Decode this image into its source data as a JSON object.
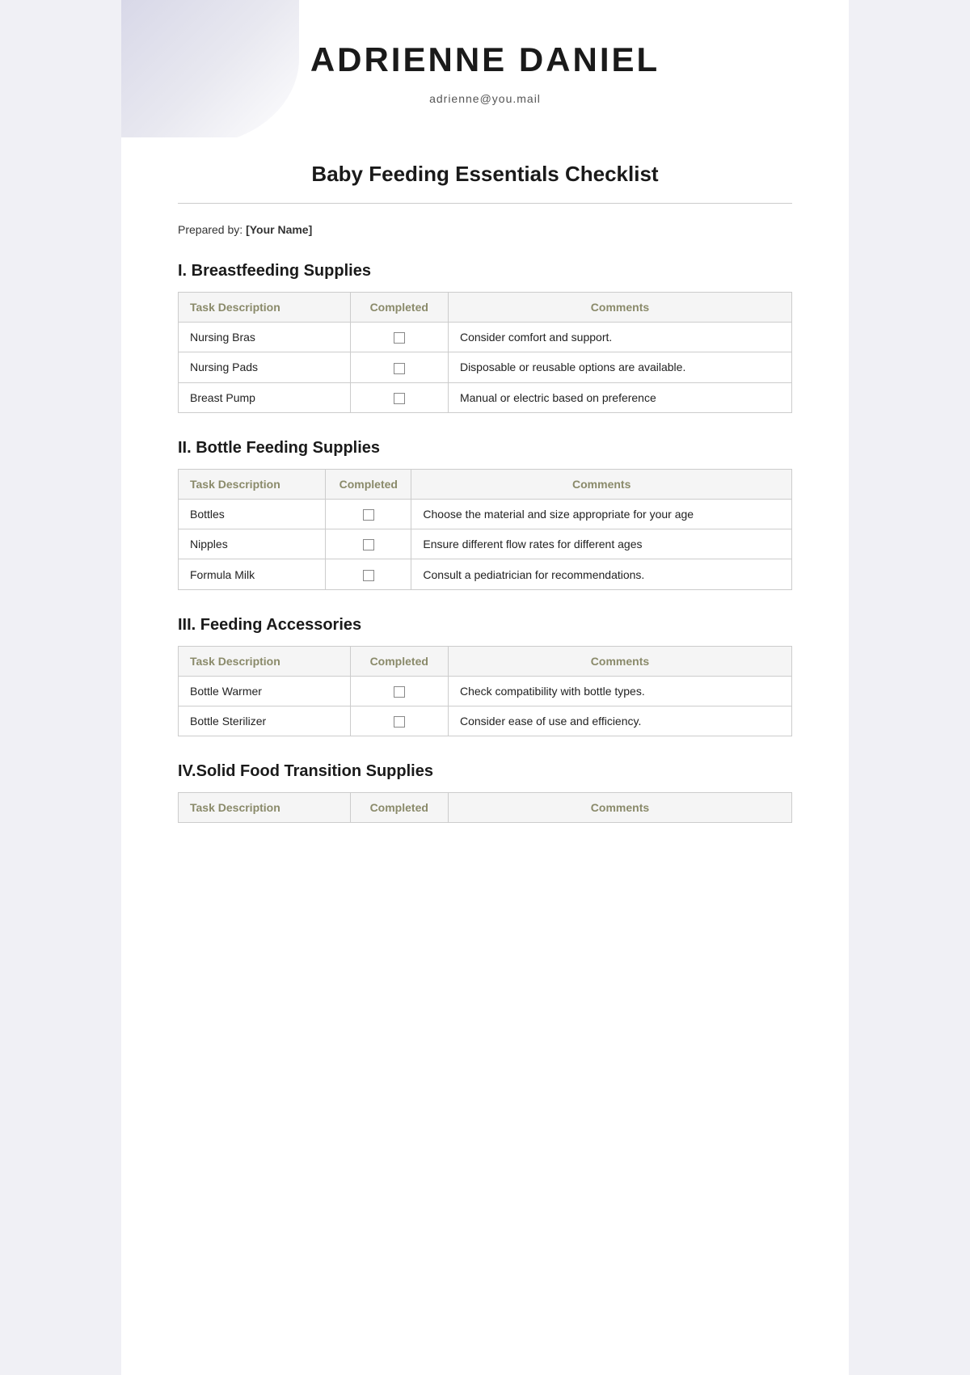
{
  "header": {
    "name": "ADRIENNE DANIEL",
    "email": "adrienne@you.mail"
  },
  "document": {
    "title": "Baby Feeding Essentials Checklist",
    "prepared_by_label": "Prepared by:",
    "prepared_by_value": "[Your Name]"
  },
  "sections": [
    {
      "id": "breastfeeding",
      "title": "I. Breastfeeding Supplies",
      "columns": [
        "Task Description",
        "Completed",
        "Comments"
      ],
      "rows": [
        {
          "task": "Nursing Bras",
          "completed": false,
          "comments": "Consider comfort and support."
        },
        {
          "task": "Nursing Pads",
          "completed": false,
          "comments": "Disposable or reusable options are available."
        },
        {
          "task": "Breast Pump",
          "completed": false,
          "comments": "Manual or electric based on preference"
        }
      ]
    },
    {
      "id": "bottle-feeding",
      "title": "II. Bottle Feeding Supplies",
      "columns": [
        "Task Description",
        "Completed",
        "Comments"
      ],
      "rows": [
        {
          "task": "Bottles",
          "completed": false,
          "comments": "Choose the material and size appropriate for your age"
        },
        {
          "task": "Nipples",
          "completed": false,
          "comments": "Ensure different flow rates for different ages"
        },
        {
          "task": "Formula Milk",
          "completed": false,
          "comments": "Consult a pediatrician for recommendations."
        }
      ]
    },
    {
      "id": "feeding-accessories",
      "title": "III. Feeding Accessories",
      "columns": [
        "Task Description",
        "Completed",
        "Comments"
      ],
      "rows": [
        {
          "task": "Bottle Warmer",
          "completed": false,
          "comments": "Check compatibility with bottle types."
        },
        {
          "task": "Bottle Sterilizer",
          "completed": false,
          "comments": "Consider ease of use and efficiency."
        }
      ]
    },
    {
      "id": "solid-food",
      "title": "IV.Solid Food Transition Supplies",
      "columns": [
        "Task Description",
        "Completed",
        "Comments"
      ],
      "rows": []
    }
  ]
}
